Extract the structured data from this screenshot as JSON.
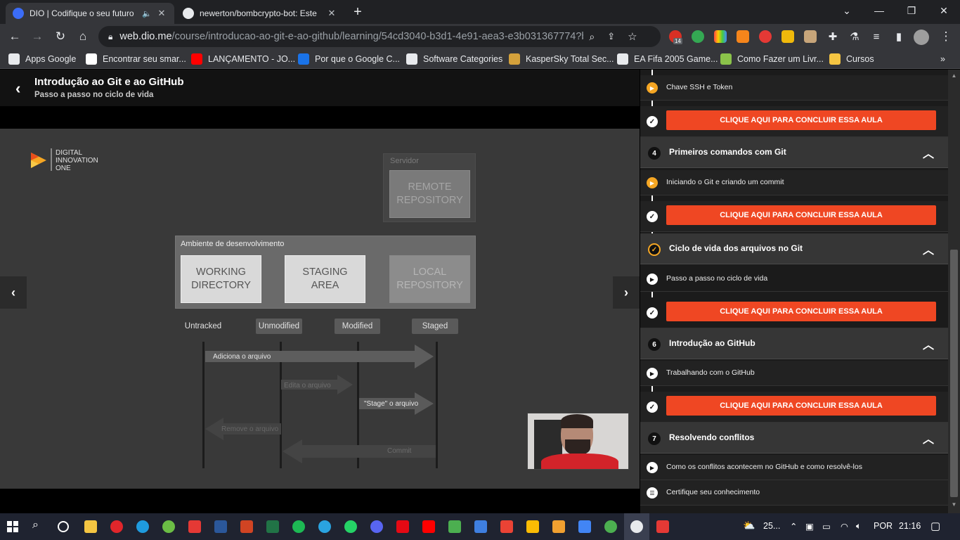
{
  "browser": {
    "tabs": [
      {
        "title": "DIO | Codifique o seu futuro",
        "icon": "dio-icon",
        "active": true
      },
      {
        "title": "newerton/bombcrypto-bot: Este",
        "icon": "github-icon",
        "active": false
      }
    ],
    "new_tab": "+",
    "url_domain": "web.dio.me",
    "url_path": "/course/introducao-ao-git-e-ao-github/learning/54cd3040-b3d1-4e91-aea3-e3b031367774?b...",
    "extension_badge": "14"
  },
  "bookmarks": [
    {
      "label": "Apps Google",
      "icon": "apps-grid-icon",
      "color": "#e8eaed"
    },
    {
      "label": "Encontrar seu smar...",
      "icon": "google-icon",
      "color": "#ffffff"
    },
    {
      "label": "LANÇAMENTO - JO...",
      "icon": "youtube-icon",
      "color": "#ff0000"
    },
    {
      "label": "Por que o Google C...",
      "icon": "bookmark-blue-icon",
      "color": "#1a73e8"
    },
    {
      "label": "Software Categories",
      "icon": "globe-icon",
      "color": "#e8eaed"
    },
    {
      "label": "KasperSky Total Sec...",
      "icon": "kaspersky-icon",
      "color": "#d4a13b"
    },
    {
      "label": "EA Fifa 2005 Game...",
      "icon": "globe-icon",
      "color": "#e8eaed"
    },
    {
      "label": "Como Fazer um Livr...",
      "icon": "site-icon",
      "color": "#8bc34a"
    },
    {
      "label": "Cursos",
      "icon": "folder-icon",
      "color": "#f5c542"
    }
  ],
  "header": {
    "title": "Introdução ao Git e ao GitHub",
    "subtitle": "Passo a passo no ciclo de vida"
  },
  "slide": {
    "logo_lines": [
      "DIGITAL",
      "INNOVATION",
      "ONE"
    ],
    "server_label": "Servidor",
    "remote_repo": "REMOTE\nREPOSITORY",
    "dev_env_label": "Ambiente de desenvolvimento",
    "working_dir": "WORKING\nDIRECTORY",
    "staging_area": "STAGING\nAREA",
    "local_repo": "LOCAL\nREPOSITORY",
    "states": [
      "Untracked",
      "Unmodified",
      "Modified",
      "Staged"
    ],
    "arrows": {
      "add": "Adiciona o arquivo",
      "edit": "Edita o arquivo",
      "stage": "\"Stage\" o arquivo",
      "remove": "Remove o arquivo",
      "commit": "Commit"
    }
  },
  "sidebar": {
    "rows": [
      {
        "kind": "lesson",
        "label": "Chave SSH e Token",
        "icon": "play-orange"
      },
      {
        "kind": "done",
        "label": "CLIQUE AQUI PARA CONCLUIR ESSA AULA"
      },
      {
        "kind": "module",
        "number": "4",
        "title": "Primeiros comandos com Git"
      },
      {
        "kind": "lesson",
        "label": "Iniciando o Git e criando um commit",
        "icon": "play-orange"
      },
      {
        "kind": "done",
        "label": "CLIQUE AQUI PARA CONCLUIR ESSA AULA"
      },
      {
        "kind": "module",
        "number": "✓",
        "title": "Ciclo de vida dos arquivos no Git"
      },
      {
        "kind": "lesson",
        "label": "Passo a passo no ciclo de vida",
        "icon": "play-white"
      },
      {
        "kind": "done",
        "label": "CLIQUE AQUI PARA CONCLUIR ESSA AULA"
      },
      {
        "kind": "module",
        "number": "6",
        "title": "Introdução ao GitHub"
      },
      {
        "kind": "lesson",
        "label": "Trabalhando com o GitHub",
        "icon": "play-white"
      },
      {
        "kind": "done",
        "label": "CLIQUE AQUI PARA CONCLUIR ESSA AULA"
      },
      {
        "kind": "module",
        "number": "7",
        "title": "Resolvendo conflitos"
      },
      {
        "kind": "lesson",
        "label": "Como os conflitos acontecem no GitHub e como resolvê-los",
        "icon": "play-white"
      },
      {
        "kind": "lesson",
        "label": "Certifique seu conhecimento",
        "icon": "list-white"
      }
    ],
    "accent": "#ef4723"
  },
  "taskbar": {
    "weather": "25...",
    "lang": "POR",
    "time": "21:16"
  }
}
